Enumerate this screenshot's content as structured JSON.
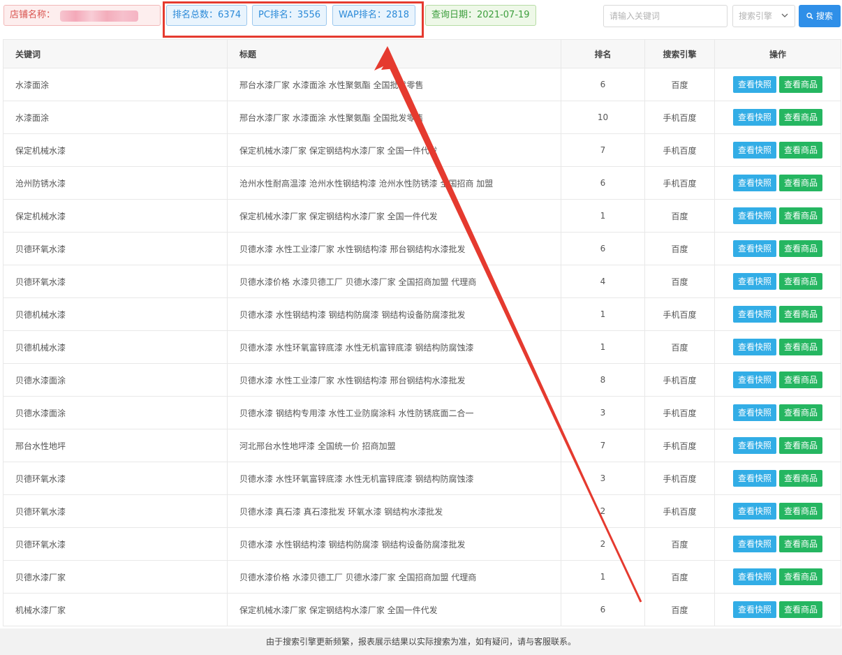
{
  "header": {
    "store_label": "店铺名称：",
    "total_rank_label": "排名总数：",
    "total_rank_value": "6374",
    "pc_rank_label": "PC排名：",
    "pc_rank_value": "3556",
    "wap_rank_label": "WAP排名：",
    "wap_rank_value": "2818",
    "date_label": "查询日期：",
    "date_value": "2021-07-19"
  },
  "search": {
    "placeholder": "请输入关键词",
    "engine_placeholder": "搜索引擎",
    "button_label": "搜索"
  },
  "table": {
    "columns": [
      "关键词",
      "标题",
      "排名",
      "搜索引擎",
      "操作"
    ],
    "action_labels": {
      "snapshot": "查看快照",
      "goods": "查看商品"
    },
    "rows": [
      {
        "keyword": "水漆面涂",
        "title": "邢台水漆厂家 水漆面涂 水性聚氨酯 全国批发零售",
        "rank": "6",
        "engine": "百度"
      },
      {
        "keyword": "水漆面涂",
        "title": "邢台水漆厂家 水漆面涂 水性聚氨酯 全国批发零售",
        "rank": "10",
        "engine": "手机百度"
      },
      {
        "keyword": "保定机械水漆",
        "title": "保定机械水漆厂家 保定钢结构水漆厂家 全国一件代发",
        "rank": "7",
        "engine": "手机百度"
      },
      {
        "keyword": "沧州防锈水漆",
        "title": "沧州水性耐高温漆 沧州水性钢结构漆 沧州水性防锈漆 全国招商 加盟",
        "rank": "6",
        "engine": "手机百度"
      },
      {
        "keyword": "保定机械水漆",
        "title": "保定机械水漆厂家 保定钢结构水漆厂家 全国一件代发",
        "rank": "1",
        "engine": "百度"
      },
      {
        "keyword": "贝德环氧水漆",
        "title": "贝德水漆 水性工业漆厂家 水性钢结构漆 邢台钢结构水漆批发",
        "rank": "6",
        "engine": "百度"
      },
      {
        "keyword": "贝德环氧水漆",
        "title": "贝德水漆价格 水漆贝德工厂 贝德水漆厂家 全国招商加盟 代理商",
        "rank": "4",
        "engine": "百度"
      },
      {
        "keyword": "贝德机械水漆",
        "title": "贝德水漆 水性钢结构漆 钢结构防腐漆 钢结构设备防腐漆批发",
        "rank": "1",
        "engine": "手机百度"
      },
      {
        "keyword": "贝德机械水漆",
        "title": "贝德水漆 水性环氧富锌底漆 水性无机富锌底漆 钢结构防腐蚀漆",
        "rank": "1",
        "engine": "百度"
      },
      {
        "keyword": "贝德水漆面涂",
        "title": "贝德水漆 水性工业漆厂家 水性钢结构漆 邢台钢结构水漆批发",
        "rank": "8",
        "engine": "手机百度"
      },
      {
        "keyword": "贝德水漆面涂",
        "title": "贝德水漆 钢结构专用漆 水性工业防腐涂料 水性防锈底面二合一",
        "rank": "3",
        "engine": "手机百度"
      },
      {
        "keyword": "邢台水性地坪",
        "title": "河北邢台水性地坪漆 全国统一价 招商加盟",
        "rank": "7",
        "engine": "手机百度"
      },
      {
        "keyword": "贝德环氧水漆",
        "title": "贝德水漆 水性环氧富锌底漆 水性无机富锌底漆 钢结构防腐蚀漆",
        "rank": "3",
        "engine": "手机百度"
      },
      {
        "keyword": "贝德环氧水漆",
        "title": "贝德水漆 真石漆 真石漆批发 环氧水漆 钢结构水漆批发",
        "rank": "2",
        "engine": "手机百度"
      },
      {
        "keyword": "贝德环氧水漆",
        "title": "贝德水漆 水性钢结构漆 钢结构防腐漆 钢结构设备防腐漆批发",
        "rank": "2",
        "engine": "百度"
      },
      {
        "keyword": "贝德水漆厂家",
        "title": "贝德水漆价格 水漆贝德工厂 贝德水漆厂家 全国招商加盟 代理商",
        "rank": "1",
        "engine": "百度"
      },
      {
        "keyword": "机械水漆厂家",
        "title": "保定机械水漆厂家 保定钢结构水漆厂家 全国一件代发",
        "rank": "6",
        "engine": "百度"
      }
    ]
  },
  "footer": {
    "notice": "由于搜索引擎更新频繁，报表展示结果以实际搜索为准，如有疑问，请与客服联系。"
  },
  "colors": {
    "highlight_red": "#e53a2f",
    "snapshot_button": "#32ade6",
    "goods_button": "#25b661",
    "search_button": "#2f8fe8"
  },
  "icons": {
    "search_button_icon": "search-icon",
    "select_chevron": "chevron-down-icon"
  }
}
